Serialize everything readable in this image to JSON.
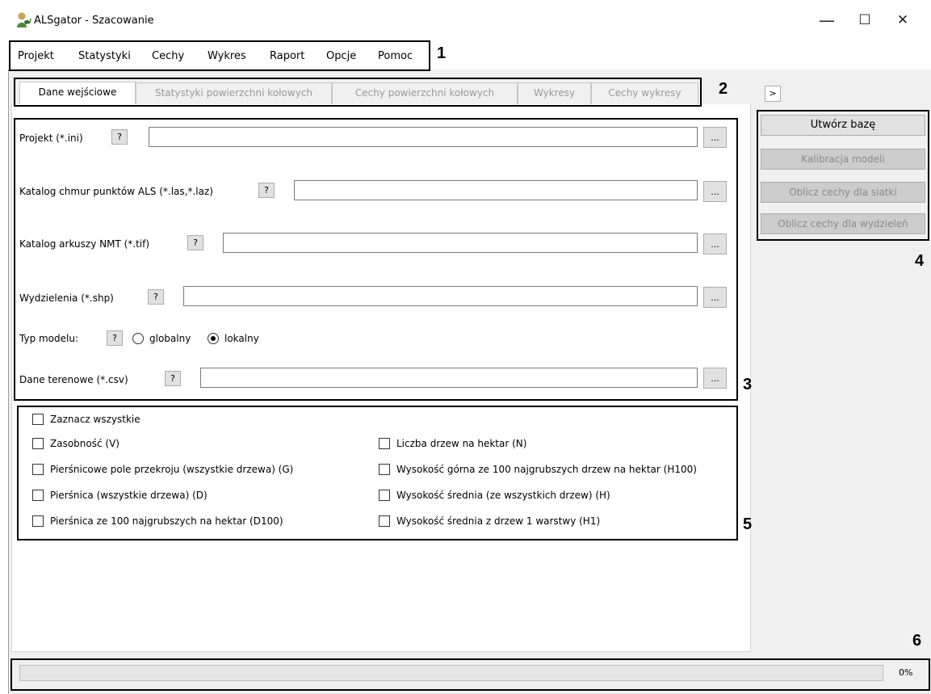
{
  "window": {
    "title": "ALSgator - Szacowanie"
  },
  "window_controls": {
    "minimize": "—",
    "maximize": "☐",
    "close": "✕"
  },
  "menu": [
    "Projekt",
    "Statystyki",
    "Cechy",
    "Wykres",
    "Raport",
    "Opcje",
    "Pomoc"
  ],
  "tabs": [
    {
      "label": "Dane wejściowe",
      "active": true
    },
    {
      "label": "Statystyki powierzchni kołowych",
      "active": false
    },
    {
      "label": "Cechy powierzchni kołowych",
      "active": false
    },
    {
      "label": "Wykresy",
      "active": false
    },
    {
      "label": "Cechy wykresy",
      "active": false
    }
  ],
  "collapse_label": ">",
  "fields": {
    "project": {
      "label": "Projekt (*.ini)",
      "value": ""
    },
    "als_catalog": {
      "label": "Katalog chmur punktów ALS (*.las,*.laz)",
      "value": ""
    },
    "dtm_catalog": {
      "label": "Katalog arkuszy NMT (*.tif)",
      "value": ""
    },
    "subdivisions": {
      "label": "Wydzielenia (*.shp)",
      "value": ""
    },
    "field_data": {
      "label": "Dane terenowe (*.csv)",
      "value": ""
    }
  },
  "help_label": "?",
  "browse_label": "...",
  "model_type": {
    "label": "Typ modelu:",
    "options": [
      "globalny",
      "lokalny"
    ],
    "selected": "lokalny"
  },
  "checkboxes": {
    "select_all": "Zaznacz wszystkie",
    "left": [
      "Zasobność (V)",
      "Pierśnicowe pole przekroju (wszystkie drzewa) (G)",
      "Pierśnica (wszystkie drzewa) (D)",
      "Pierśnica ze 100 najgrubszych na hektar (D100)"
    ],
    "right": [
      "Liczba drzew na hektar (N)",
      "Wysokość górna ze 100 najgrubszych drzew na hektar (H100)",
      "Wysokość średnia (ze wszystkich drzew) (H)",
      "Wysokość średnia z drzew 1 warstwy (H1)"
    ]
  },
  "side_buttons": [
    {
      "label": "Utwórz bazę",
      "enabled": true
    },
    {
      "label": "Kalibracja modeli",
      "enabled": false
    },
    {
      "label": "Oblicz cechy dla siatki",
      "enabled": false
    },
    {
      "label": "Oblicz cechy dla wydzieleń",
      "enabled": false
    }
  ],
  "progress": {
    "value": 0,
    "text": "0%"
  },
  "annotations": [
    "1",
    "2",
    "3",
    "4",
    "5",
    "6"
  ]
}
